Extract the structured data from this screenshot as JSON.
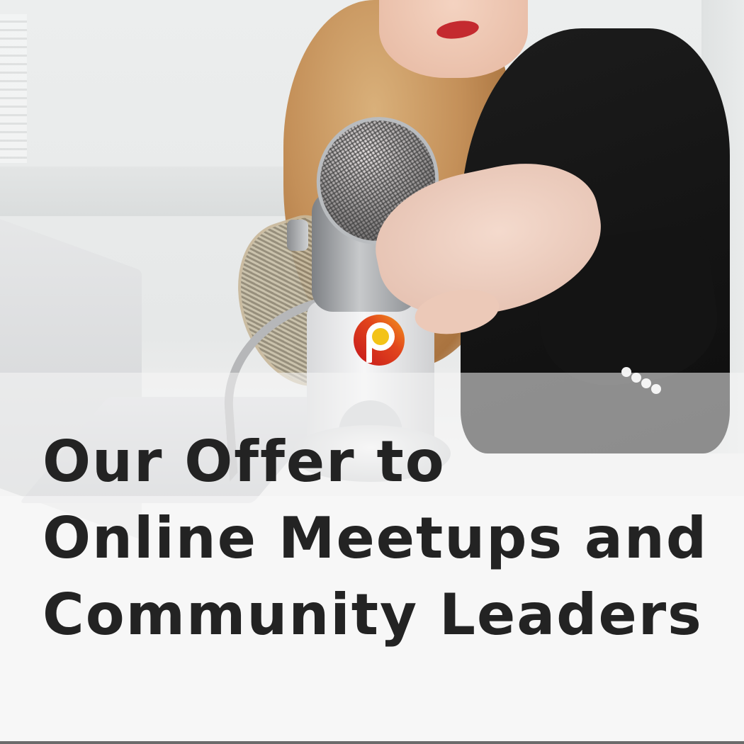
{
  "headline": {
    "lines": [
      "Our Offer to",
      "Online Meetups and",
      "Community Leaders"
    ]
  },
  "logo": {
    "icon": "p-circle-logo",
    "colors": {
      "ring_outer": "#c5161d",
      "ring_inner": "#f39a1f",
      "dot": "#f3c318",
      "letter": "#ffffff"
    }
  },
  "colors": {
    "headline_text": "#232323",
    "overlay": "#f5f5f5"
  }
}
